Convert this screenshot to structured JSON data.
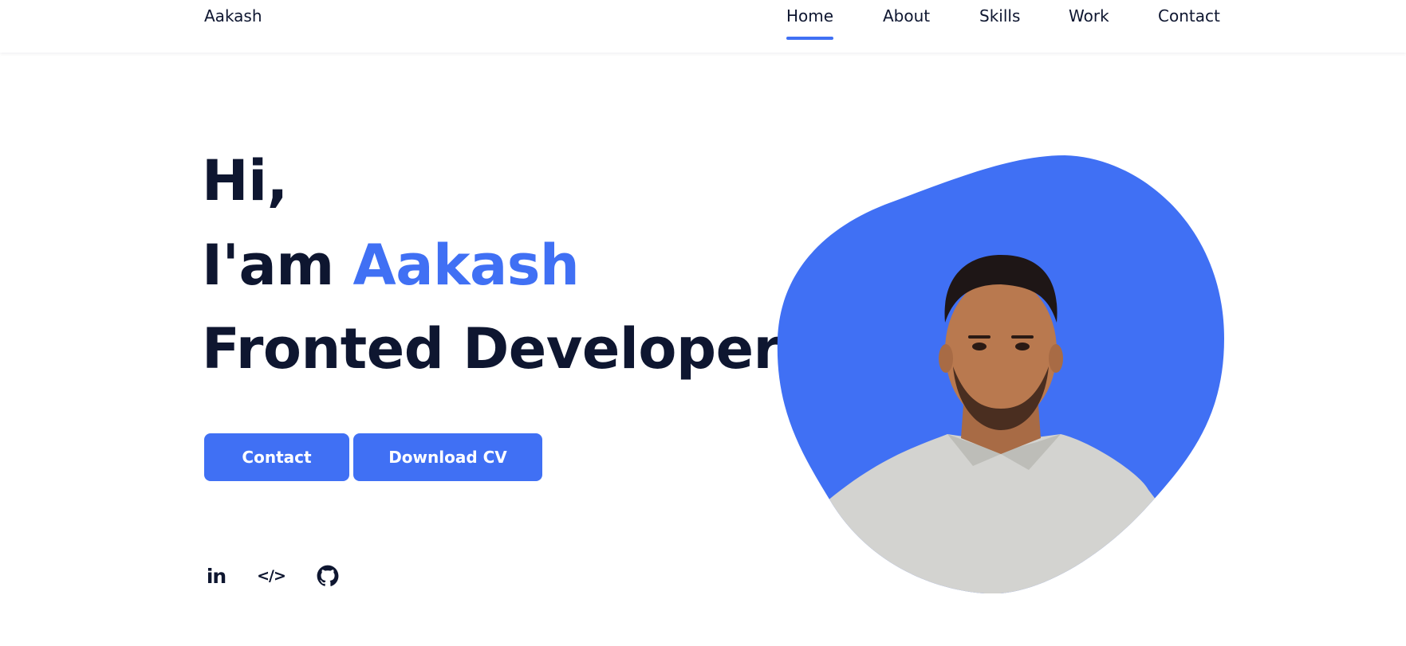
{
  "header": {
    "logo": "Aakash",
    "nav": [
      {
        "label": "Home",
        "active": true
      },
      {
        "label": "About",
        "active": false
      },
      {
        "label": "Skills",
        "active": false
      },
      {
        "label": "Work",
        "active": false
      },
      {
        "label": "Contact",
        "active": false
      }
    ]
  },
  "hero": {
    "line1": "Hi,",
    "line2_prefix": "I'am ",
    "line2_name": "Aakash",
    "line3": "Fronted Developer",
    "buttons": {
      "contact": "Contact",
      "download_cv": "Download CV"
    },
    "social": {
      "linkedin": "in",
      "codepen": "</>",
      "github": "github-icon"
    }
  },
  "colors": {
    "accent": "#4070f4",
    "text": "#0e1630",
    "background": "#ffffff"
  }
}
